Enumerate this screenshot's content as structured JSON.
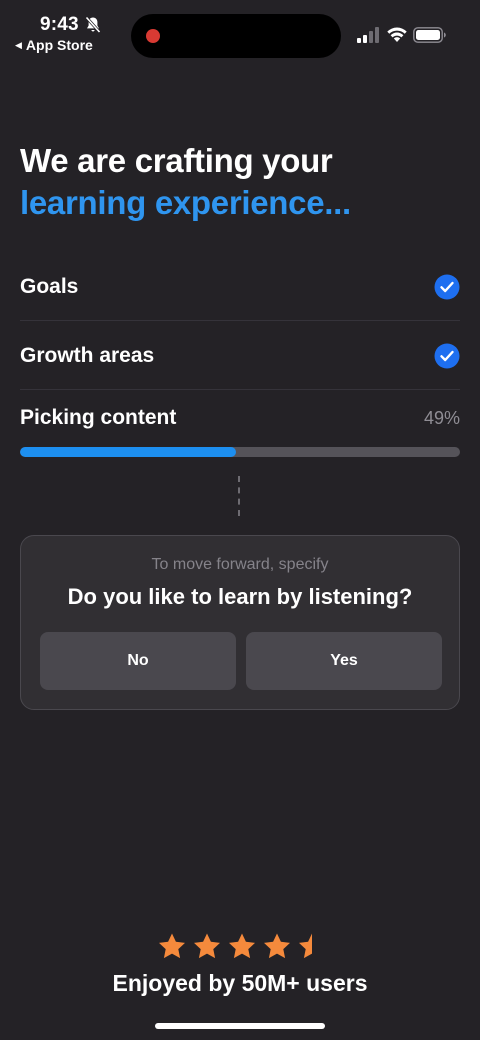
{
  "status_bar": {
    "time": "9:43",
    "back_label": "App Store",
    "back_arrow": "◀"
  },
  "title": {
    "line1": "We are crafting your",
    "line2": "learning experience..."
  },
  "steps": [
    {
      "label": "Goals",
      "status": "done"
    },
    {
      "label": "Growth areas",
      "status": "done"
    }
  ],
  "current_step": {
    "label": "Picking content",
    "percent_text": "49%",
    "progress": 0.49
  },
  "question_card": {
    "hint": "To move forward, specify",
    "question": "Do you like to learn by listening?",
    "options": [
      "No",
      "Yes"
    ]
  },
  "footer": {
    "rating": 4.5,
    "text": "Enjoyed by 50M+ users"
  },
  "colors": {
    "background": "#242226",
    "accent_blue": "#2f95ef",
    "check_blue": "#1e6ff0",
    "star_orange": "#f58a3c"
  },
  "icons": {
    "check": "check-circle-icon",
    "star": "star-icon",
    "bell_off": "bell-slash-icon"
  }
}
